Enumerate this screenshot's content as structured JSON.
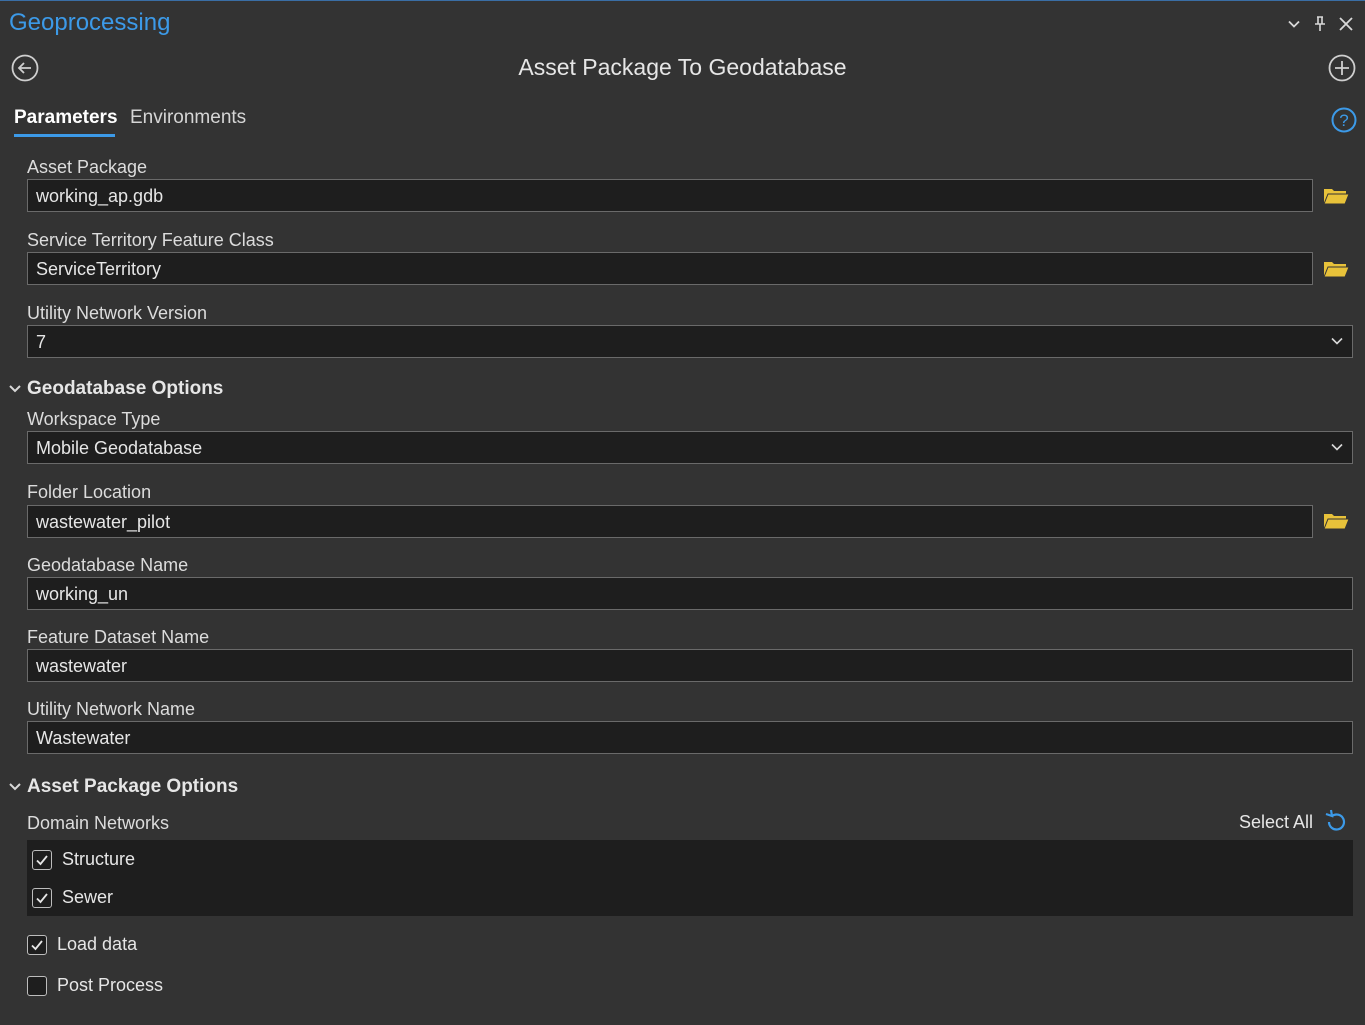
{
  "pane": {
    "title": "Geoprocessing",
    "controls": [
      "chevron-down-icon",
      "pin-icon",
      "close-icon"
    ]
  },
  "tool": {
    "title": "Asset Package To Geodatabase",
    "back_icon": "back-arrow-icon",
    "add_icon": "add-circle-icon"
  },
  "tabs": [
    {
      "label": "Parameters",
      "active": true
    },
    {
      "label": "Environments",
      "active": false
    }
  ],
  "help_icon": "help-icon",
  "params": {
    "asset_package": {
      "label": "Asset Package",
      "value": "working_ap.gdb"
    },
    "service_territory": {
      "label": "Service Territory Feature Class",
      "value": "ServiceTerritory"
    },
    "un_version": {
      "label": "Utility Network Version",
      "value": "7"
    }
  },
  "gdb_options": {
    "heading": "Geodatabase Options",
    "workspace_type": {
      "label": "Workspace Type",
      "value": "Mobile Geodatabase"
    },
    "folder_location": {
      "label": "Folder Location",
      "value": "wastewater_pilot"
    },
    "gdb_name": {
      "label": "Geodatabase Name",
      "value": "working_un"
    },
    "fd_name": {
      "label": "Feature Dataset Name",
      "value": "wastewater"
    },
    "un_name": {
      "label": "Utility Network Name",
      "value": "Wastewater"
    }
  },
  "ap_options": {
    "heading": "Asset Package Options",
    "domain_networks_label": "Domain Networks",
    "select_all": "Select All",
    "domain_networks": [
      {
        "label": "Structure",
        "checked": true
      },
      {
        "label": "Sewer",
        "checked": true
      }
    ],
    "load_data": {
      "label": "Load data",
      "checked": true
    },
    "post_process": {
      "label": "Post Process",
      "checked": false
    }
  },
  "colors": {
    "accent": "#3c9ae8",
    "folder": "#e8c23a",
    "background": "#333333",
    "field_bg": "#1e1e1e"
  }
}
